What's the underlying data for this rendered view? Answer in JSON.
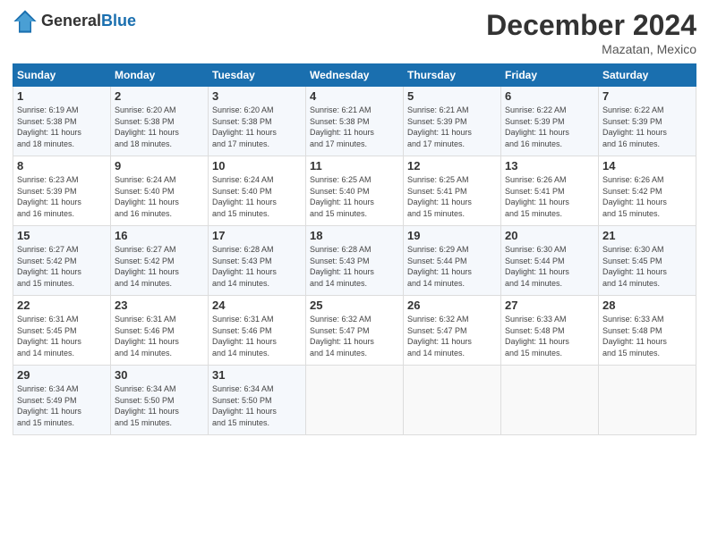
{
  "header": {
    "logo_line1": "General",
    "logo_line2": "Blue",
    "month_title": "December 2024",
    "location": "Mazatan, Mexico"
  },
  "weekdays": [
    "Sunday",
    "Monday",
    "Tuesday",
    "Wednesday",
    "Thursday",
    "Friday",
    "Saturday"
  ],
  "weeks": [
    [
      {
        "day": "1",
        "detail": "Sunrise: 6:19 AM\nSunset: 5:38 PM\nDaylight: 11 hours\nand 18 minutes."
      },
      {
        "day": "2",
        "detail": "Sunrise: 6:20 AM\nSunset: 5:38 PM\nDaylight: 11 hours\nand 18 minutes."
      },
      {
        "day": "3",
        "detail": "Sunrise: 6:20 AM\nSunset: 5:38 PM\nDaylight: 11 hours\nand 17 minutes."
      },
      {
        "day": "4",
        "detail": "Sunrise: 6:21 AM\nSunset: 5:38 PM\nDaylight: 11 hours\nand 17 minutes."
      },
      {
        "day": "5",
        "detail": "Sunrise: 6:21 AM\nSunset: 5:39 PM\nDaylight: 11 hours\nand 17 minutes."
      },
      {
        "day": "6",
        "detail": "Sunrise: 6:22 AM\nSunset: 5:39 PM\nDaylight: 11 hours\nand 16 minutes."
      },
      {
        "day": "7",
        "detail": "Sunrise: 6:22 AM\nSunset: 5:39 PM\nDaylight: 11 hours\nand 16 minutes."
      }
    ],
    [
      {
        "day": "8",
        "detail": "Sunrise: 6:23 AM\nSunset: 5:39 PM\nDaylight: 11 hours\nand 16 minutes."
      },
      {
        "day": "9",
        "detail": "Sunrise: 6:24 AM\nSunset: 5:40 PM\nDaylight: 11 hours\nand 16 minutes."
      },
      {
        "day": "10",
        "detail": "Sunrise: 6:24 AM\nSunset: 5:40 PM\nDaylight: 11 hours\nand 15 minutes."
      },
      {
        "day": "11",
        "detail": "Sunrise: 6:25 AM\nSunset: 5:40 PM\nDaylight: 11 hours\nand 15 minutes."
      },
      {
        "day": "12",
        "detail": "Sunrise: 6:25 AM\nSunset: 5:41 PM\nDaylight: 11 hours\nand 15 minutes."
      },
      {
        "day": "13",
        "detail": "Sunrise: 6:26 AM\nSunset: 5:41 PM\nDaylight: 11 hours\nand 15 minutes."
      },
      {
        "day": "14",
        "detail": "Sunrise: 6:26 AM\nSunset: 5:42 PM\nDaylight: 11 hours\nand 15 minutes."
      }
    ],
    [
      {
        "day": "15",
        "detail": "Sunrise: 6:27 AM\nSunset: 5:42 PM\nDaylight: 11 hours\nand 15 minutes."
      },
      {
        "day": "16",
        "detail": "Sunrise: 6:27 AM\nSunset: 5:42 PM\nDaylight: 11 hours\nand 14 minutes."
      },
      {
        "day": "17",
        "detail": "Sunrise: 6:28 AM\nSunset: 5:43 PM\nDaylight: 11 hours\nand 14 minutes."
      },
      {
        "day": "18",
        "detail": "Sunrise: 6:28 AM\nSunset: 5:43 PM\nDaylight: 11 hours\nand 14 minutes."
      },
      {
        "day": "19",
        "detail": "Sunrise: 6:29 AM\nSunset: 5:44 PM\nDaylight: 11 hours\nand 14 minutes."
      },
      {
        "day": "20",
        "detail": "Sunrise: 6:30 AM\nSunset: 5:44 PM\nDaylight: 11 hours\nand 14 minutes."
      },
      {
        "day": "21",
        "detail": "Sunrise: 6:30 AM\nSunset: 5:45 PM\nDaylight: 11 hours\nand 14 minutes."
      }
    ],
    [
      {
        "day": "22",
        "detail": "Sunrise: 6:31 AM\nSunset: 5:45 PM\nDaylight: 11 hours\nand 14 minutes."
      },
      {
        "day": "23",
        "detail": "Sunrise: 6:31 AM\nSunset: 5:46 PM\nDaylight: 11 hours\nand 14 minutes."
      },
      {
        "day": "24",
        "detail": "Sunrise: 6:31 AM\nSunset: 5:46 PM\nDaylight: 11 hours\nand 14 minutes."
      },
      {
        "day": "25",
        "detail": "Sunrise: 6:32 AM\nSunset: 5:47 PM\nDaylight: 11 hours\nand 14 minutes."
      },
      {
        "day": "26",
        "detail": "Sunrise: 6:32 AM\nSunset: 5:47 PM\nDaylight: 11 hours\nand 14 minutes."
      },
      {
        "day": "27",
        "detail": "Sunrise: 6:33 AM\nSunset: 5:48 PM\nDaylight: 11 hours\nand 15 minutes."
      },
      {
        "day": "28",
        "detail": "Sunrise: 6:33 AM\nSunset: 5:48 PM\nDaylight: 11 hours\nand 15 minutes."
      }
    ],
    [
      {
        "day": "29",
        "detail": "Sunrise: 6:34 AM\nSunset: 5:49 PM\nDaylight: 11 hours\nand 15 minutes."
      },
      {
        "day": "30",
        "detail": "Sunrise: 6:34 AM\nSunset: 5:50 PM\nDaylight: 11 hours\nand 15 minutes."
      },
      {
        "day": "31",
        "detail": "Sunrise: 6:34 AM\nSunset: 5:50 PM\nDaylight: 11 hours\nand 15 minutes."
      },
      {
        "day": "",
        "detail": ""
      },
      {
        "day": "",
        "detail": ""
      },
      {
        "day": "",
        "detail": ""
      },
      {
        "day": "",
        "detail": ""
      }
    ]
  ]
}
